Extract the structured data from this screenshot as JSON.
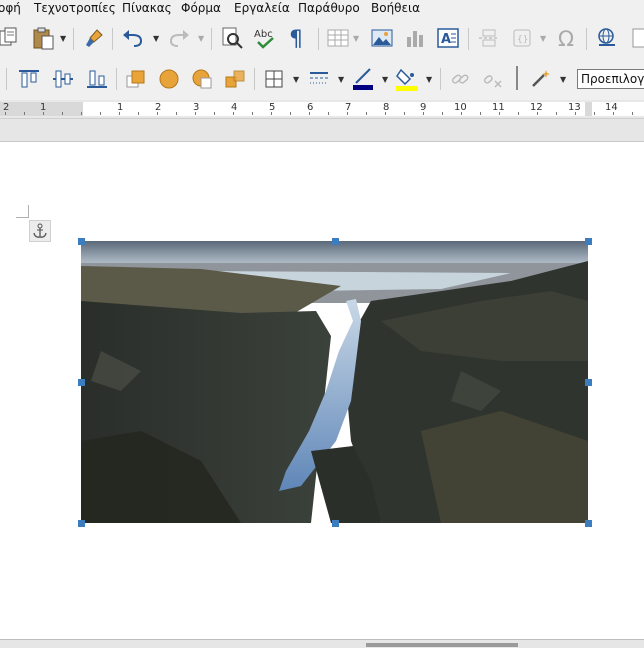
{
  "menubar": {
    "items": [
      "οφή",
      "Τεχνοτροπίες",
      "Πίνακας",
      "Φόρμα",
      "Εργαλεία",
      "Παράθυρο",
      "Βοήθεια"
    ]
  },
  "toolbar": {
    "style_box_value": "Προεπιλογή",
    "highlight_color": "#ffff00",
    "line_color": "#000080",
    "accent_orange": "#e8a33a"
  },
  "ruler": {
    "labels": [
      "2",
      "1",
      "1",
      "2",
      "3",
      "4",
      "5",
      "6",
      "7",
      "8",
      "9",
      "10",
      "11",
      "12",
      "13",
      "14"
    ]
  },
  "document": {
    "image_description_icon": "anchor-icon"
  }
}
